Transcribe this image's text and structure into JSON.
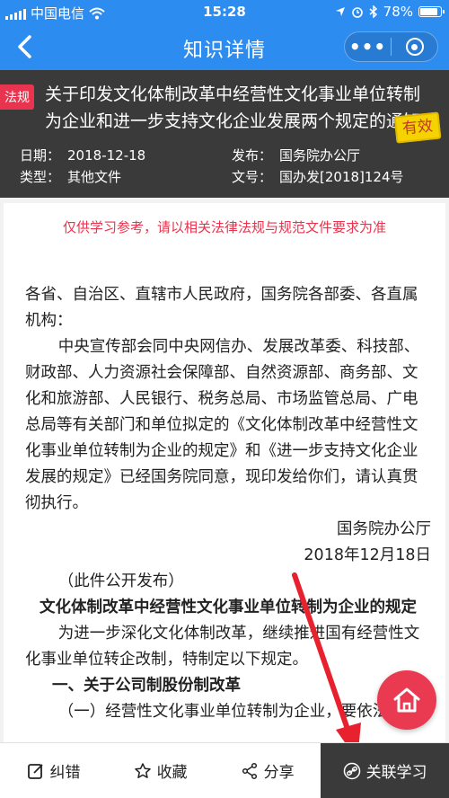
{
  "status_bar": {
    "carrier": "中国电信",
    "time": "15:28",
    "battery": "78%",
    "battery_level": 0.78
  },
  "nav": {
    "title": "知识详情",
    "more_label": "•••"
  },
  "doc": {
    "tag": "法规",
    "title": "关于印发文化体制改革中经营性文化事业单位转制为企业和进一步支持文化企业发展两个规定的通知",
    "validity": "有效",
    "date_label": "日期：",
    "date": "2018-12-18",
    "issuer_label": "发布：",
    "issuer": "国务院办公厅",
    "type_label": "类型：",
    "type": "其他文件",
    "number_label": "文号：",
    "number": "国办发[2018]124号"
  },
  "content": {
    "notice": "仅供学习参考，请以相关法律法规与规范文件要求为准",
    "salutation": "各省、自治区、直辖市人民政府，国务院各部委、各直属机构：",
    "para1": "中央宣传部会同中央网信办、发展改革委、科技部、财政部、人力资源社会保障部、自然资源部、商务部、文化和旅游部、人民银行、税务总局、市场监管总局、广电总局等有关部门和单位拟定的《文化体制改革中经营性文化事业单位转制为企业的规定》和《进一步支持文化企业发展的规定》已经国务院同意，现印发给你们，请认真贯彻执行。",
    "sign_org": "国务院办公厅",
    "sign_date": "2018年12月18日",
    "public_note": "（此件公开发布）",
    "subtitle": "文化体制改革中经营性文化事业单位转制为企业的规定",
    "para2": "为进一步深化文化体制改革，继续推进国有经营性文化事业单位转企改制，特制定以下规定。",
    "section1": "一、关于公司制股份制改革",
    "item1": "（一）经营性文化事业单位转制为企业，要依法"
  },
  "tabbar": {
    "correct": "纠错",
    "favorite": "收藏",
    "share": "分享",
    "related": "关联学习"
  },
  "colors": {
    "primary_blue": "#2d8cf0",
    "header_dark": "#3a3a3a",
    "accent_red": "#e8344e",
    "valid_yellow": "#f5d300"
  }
}
